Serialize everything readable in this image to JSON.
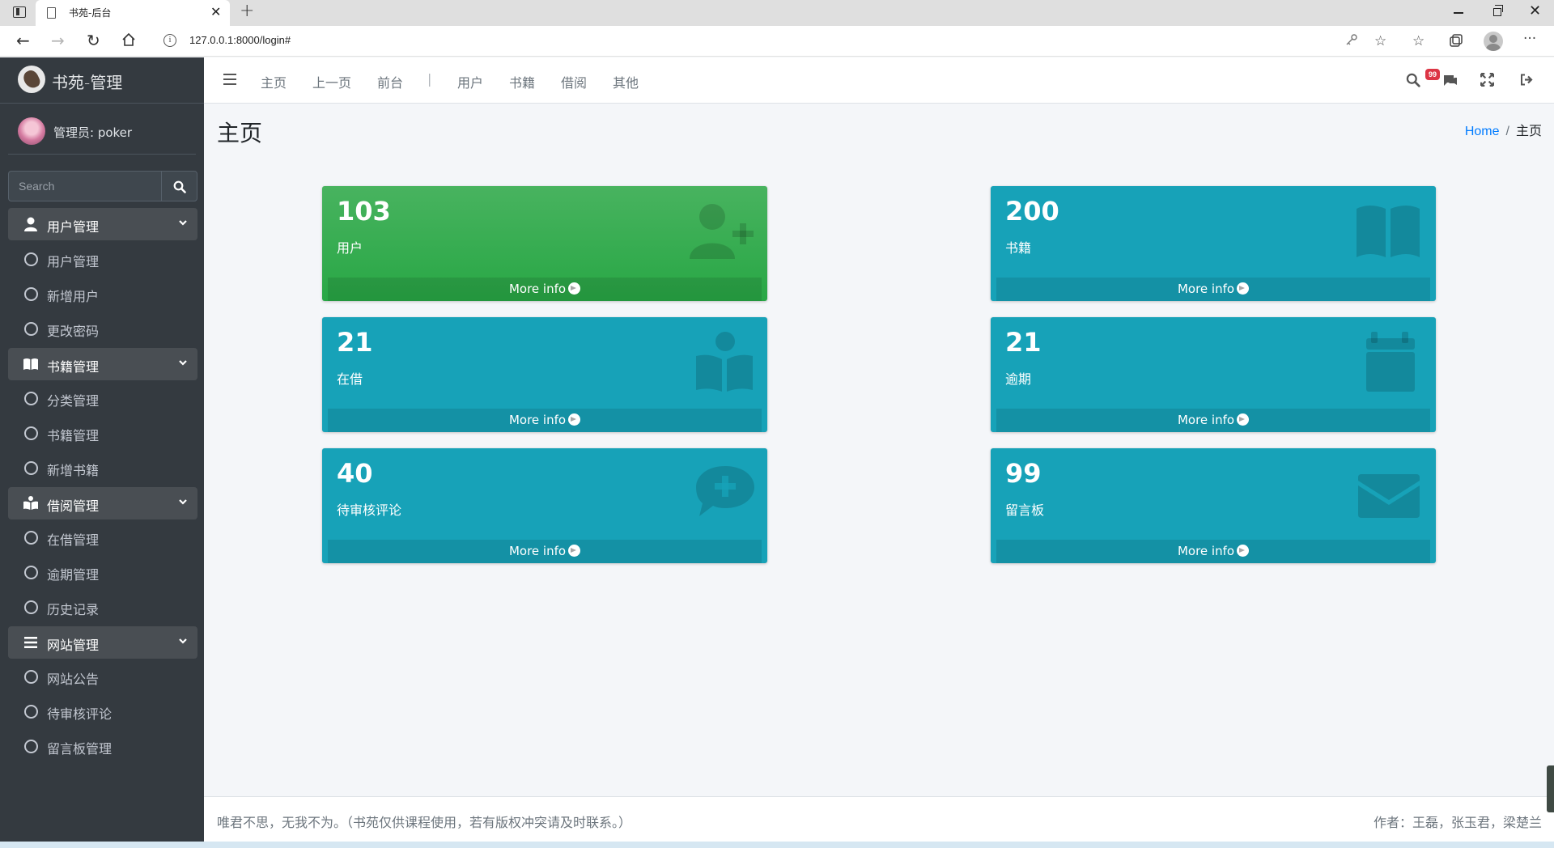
{
  "browser": {
    "tab_title": "书苑-后台",
    "url": "127.0.0.1:8000/login#"
  },
  "sidebar": {
    "brand": "书苑-管理",
    "user": "管理员: poker",
    "search_placeholder": "Search",
    "groups": [
      {
        "label": "用户管理",
        "icon": "user-icon",
        "items": [
          "用户管理",
          "新增用户",
          "更改密码"
        ]
      },
      {
        "label": "书籍管理",
        "icon": "book-open-icon",
        "items": [
          "分类管理",
          "书籍管理",
          "新增书籍"
        ]
      },
      {
        "label": "借阅管理",
        "icon": "book-reader-icon",
        "items": [
          "在借管理",
          "逾期管理",
          "历史记录"
        ]
      },
      {
        "label": "网站管理",
        "icon": "bars-icon",
        "items": [
          "网站公告",
          "待审核评论",
          "留言板管理"
        ]
      }
    ]
  },
  "topnav": {
    "links": [
      "主页",
      "上一页",
      "前台"
    ],
    "separator": "|",
    "links2": [
      "用户",
      "书籍",
      "借阅",
      "其他"
    ],
    "badge": "99"
  },
  "content": {
    "title": "主页",
    "breadcrumb": {
      "home": "Home",
      "sep": "/",
      "current": "主页"
    },
    "more_info": "More info",
    "boxes": [
      {
        "number": "103",
        "label": "用户",
        "icon": "user-plus-icon",
        "color": "#28a745"
      },
      {
        "number": "200",
        "label": "书籍",
        "icon": "book-open-icon",
        "color": "#17a2b8"
      },
      {
        "number": "21",
        "label": "在借",
        "icon": "book-reader-icon",
        "color": "#17a2b8"
      },
      {
        "number": "21",
        "label": "逾期",
        "icon": "calendar-icon",
        "color": "#17a2b8"
      },
      {
        "number": "40",
        "label": "待审核评论",
        "icon": "comment-medical-icon",
        "color": "#17a2b8"
      },
      {
        "number": "99",
        "label": "留言板",
        "icon": "envelope-icon",
        "color": "#17a2b8"
      }
    ]
  },
  "footer": {
    "left": "唯君不思，无我不为。（书苑仅供课程使用，若有版权冲突请及时联系。）",
    "right": "作者：王磊，张玉君，梁楚兰"
  }
}
